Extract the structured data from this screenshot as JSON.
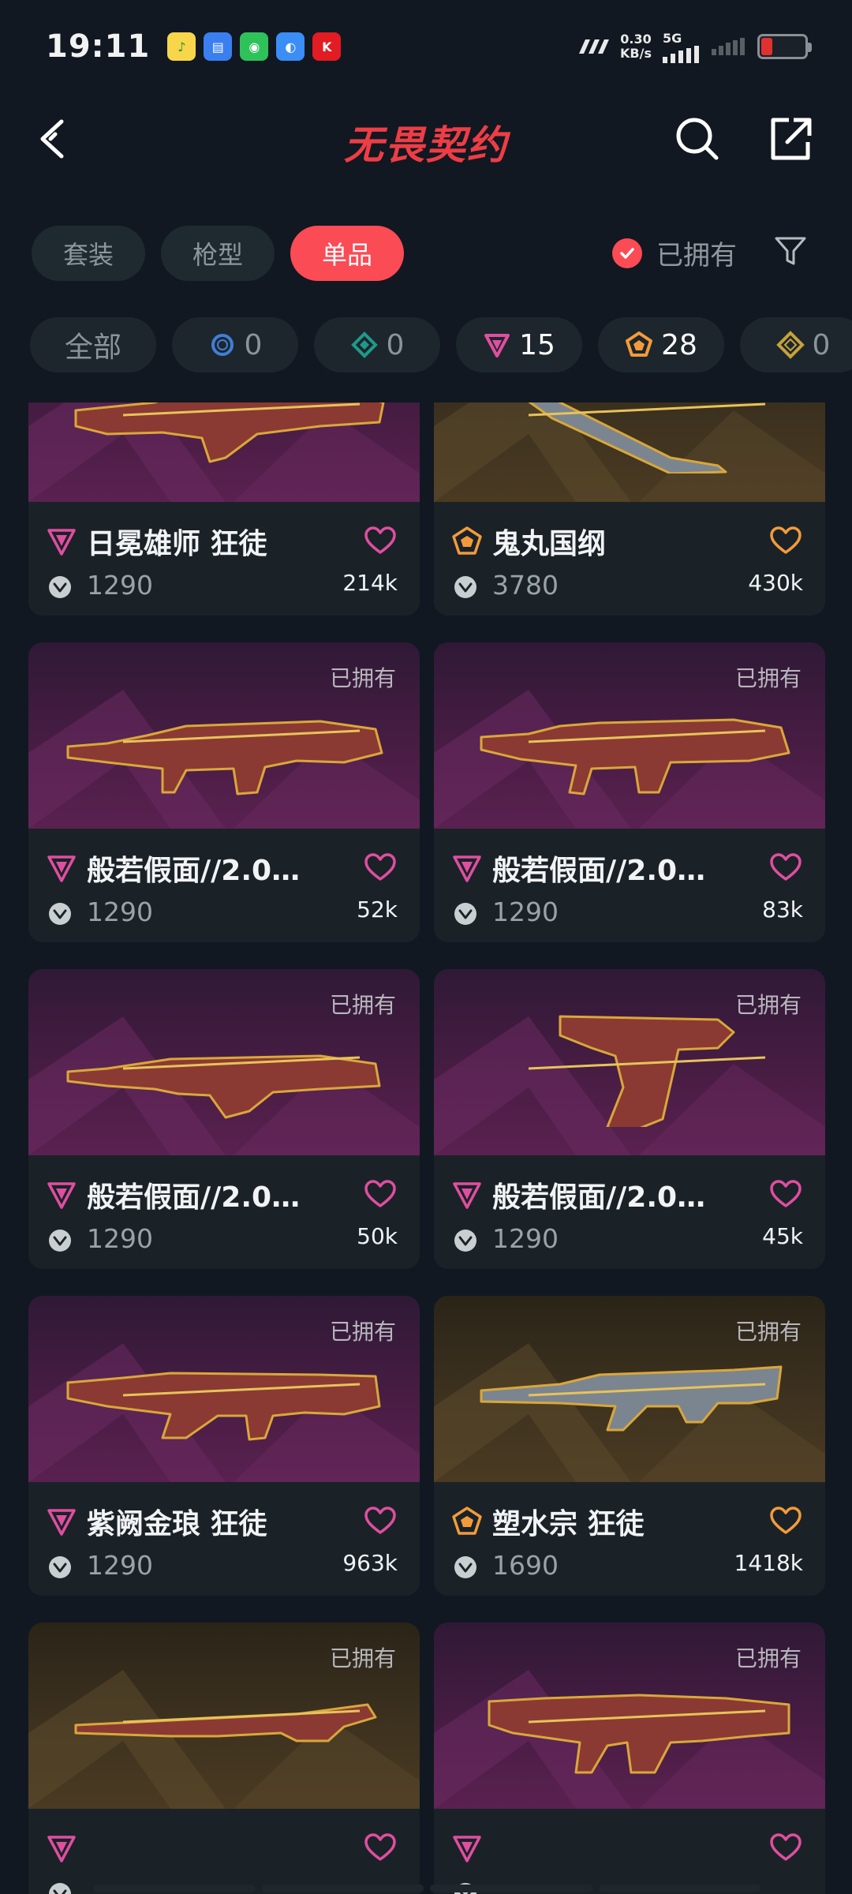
{
  "status_bar": {
    "time": "19:11",
    "net_speed_value": "0.30",
    "net_speed_unit": "KB/s",
    "network_type": "5G",
    "app_icons": [
      "qq-music-icon",
      "files-icon",
      "wechat-icon",
      "wallet-icon",
      "kfc-icon"
    ]
  },
  "header": {
    "title": "无畏契约"
  },
  "tabs": [
    {
      "label": "套装",
      "active": false
    },
    {
      "label": "枪型",
      "active": false
    },
    {
      "label": "单品",
      "active": true
    }
  ],
  "owned_filter": {
    "label": "已拥有",
    "checked": true
  },
  "chips": [
    {
      "label": "全部",
      "icon": null
    },
    {
      "count": "0",
      "icon": "select-tier-icon",
      "color": "#3f7fd6"
    },
    {
      "count": "0",
      "icon": "deluxe-tier-icon",
      "color": "#1e9a8a"
    },
    {
      "count": "15",
      "icon": "premium-tier-icon",
      "color": "#e04ea0"
    },
    {
      "count": "28",
      "icon": "exclusive-tier-icon",
      "color": "#f39b3a"
    },
    {
      "count": "0",
      "icon": "ultra-tier-icon",
      "color": "#c7a23a"
    }
  ],
  "owned_tag_label": "已拥有",
  "cards": [
    {
      "name": "日冕雄师 狂徒",
      "tier": "premium",
      "price": "1290",
      "likes": "214k",
      "owned": false,
      "bg": "purple"
    },
    {
      "name": "鬼丸国纲",
      "tier": "exclusive",
      "price": "3780",
      "likes": "430k",
      "owned": false,
      "bg": "gold"
    },
    {
      "name": "般若假面//2.0…",
      "tier": "premium",
      "price": "1290",
      "likes": "52k",
      "owned": true,
      "bg": "purple"
    },
    {
      "name": "般若假面//2.0…",
      "tier": "premium",
      "price": "1290",
      "likes": "83k",
      "owned": true,
      "bg": "purple"
    },
    {
      "name": "般若假面//2.0…",
      "tier": "premium",
      "price": "1290",
      "likes": "50k",
      "owned": true,
      "bg": "purple"
    },
    {
      "name": "般若假面//2.0…",
      "tier": "premium",
      "price": "1290",
      "likes": "45k",
      "owned": true,
      "bg": "purple"
    },
    {
      "name": "紫阙金琅 狂徒",
      "tier": "premium",
      "price": "1290",
      "likes": "963k",
      "owned": true,
      "bg": "purple"
    },
    {
      "name": "塑水宗 狂徒",
      "tier": "exclusive",
      "price": "1690",
      "likes": "1418k",
      "owned": true,
      "bg": "gold"
    },
    {
      "name": "",
      "tier": "premium",
      "price": "",
      "likes": "",
      "owned": true,
      "bg": "gold"
    },
    {
      "name": "",
      "tier": "premium",
      "price": "",
      "likes": "",
      "owned": true,
      "bg": "purple"
    }
  ],
  "colors": {
    "accent": "#fb4b55",
    "premium": "#e04ea0",
    "exclusive": "#f39b3a",
    "background": "#111821"
  }
}
